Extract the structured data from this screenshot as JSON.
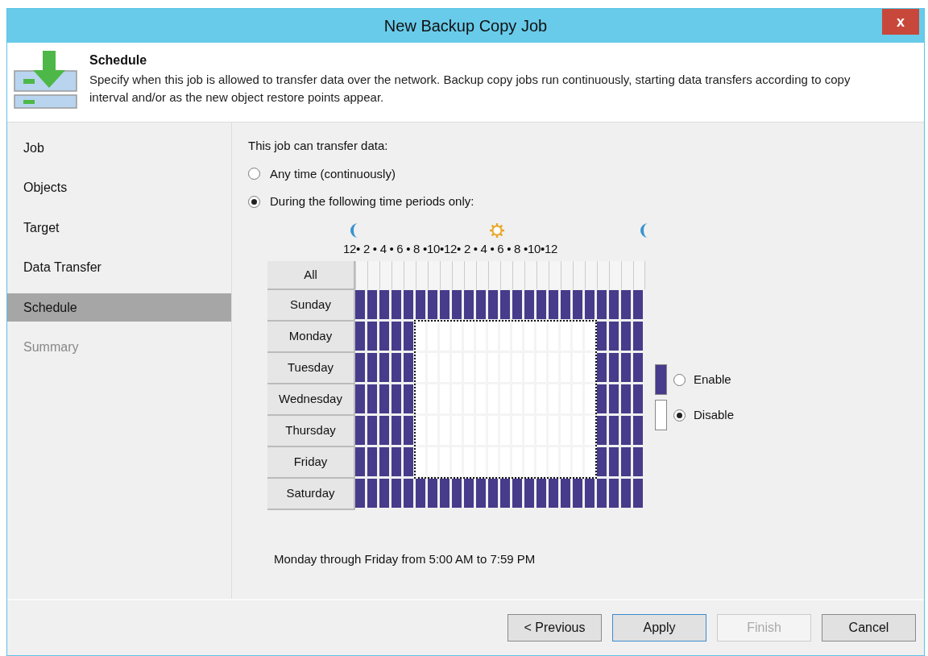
{
  "window": {
    "title": "New Backup Copy Job",
    "close": "x"
  },
  "header": {
    "title": "Schedule",
    "description": "Specify when this job is allowed to transfer data over the network. Backup copy jobs run continuously, starting data transfers according to copy interval and/or as the new object restore points appear."
  },
  "steps": [
    {
      "label": "Job",
      "selected": false,
      "disabled": false
    },
    {
      "label": "Objects",
      "selected": false,
      "disabled": false
    },
    {
      "label": "Target",
      "selected": false,
      "disabled": false
    },
    {
      "label": "Data Transfer",
      "selected": false,
      "disabled": false
    },
    {
      "label": "Schedule",
      "selected": true,
      "disabled": false
    },
    {
      "label": "Summary",
      "selected": false,
      "disabled": true
    }
  ],
  "transfer_label": "This job can transfer data:",
  "transfer_options": [
    {
      "label": "Any time (continuously)",
      "selected": false
    },
    {
      "label": "During the following time periods only:",
      "selected": true
    }
  ],
  "hour_scale": "12• 2 • 4 • 6 • 8 •10•12• 2 • 4 • 6 • 8 •10•12",
  "all_label": "All",
  "days": [
    {
      "name": "Sunday",
      "enabled": [
        true,
        true,
        true,
        true,
        true,
        true,
        true,
        true,
        true,
        true,
        true,
        true,
        true,
        true,
        true,
        true,
        true,
        true,
        true,
        true,
        true,
        true,
        true,
        true
      ]
    },
    {
      "name": "Monday",
      "enabled": [
        true,
        true,
        true,
        true,
        true,
        false,
        false,
        false,
        false,
        false,
        false,
        false,
        false,
        false,
        false,
        false,
        false,
        false,
        false,
        false,
        true,
        true,
        true,
        true
      ]
    },
    {
      "name": "Tuesday",
      "enabled": [
        true,
        true,
        true,
        true,
        true,
        false,
        false,
        false,
        false,
        false,
        false,
        false,
        false,
        false,
        false,
        false,
        false,
        false,
        false,
        false,
        true,
        true,
        true,
        true
      ]
    },
    {
      "name": "Wednesday",
      "enabled": [
        true,
        true,
        true,
        true,
        true,
        false,
        false,
        false,
        false,
        false,
        false,
        false,
        false,
        false,
        false,
        false,
        false,
        false,
        false,
        false,
        true,
        true,
        true,
        true
      ]
    },
    {
      "name": "Thursday",
      "enabled": [
        true,
        true,
        true,
        true,
        true,
        false,
        false,
        false,
        false,
        false,
        false,
        false,
        false,
        false,
        false,
        false,
        false,
        false,
        false,
        false,
        true,
        true,
        true,
        true
      ]
    },
    {
      "name": "Friday",
      "enabled": [
        true,
        true,
        true,
        true,
        true,
        false,
        false,
        false,
        false,
        false,
        false,
        false,
        false,
        false,
        false,
        false,
        false,
        false,
        false,
        false,
        true,
        true,
        true,
        true
      ]
    },
    {
      "name": "Saturday",
      "enabled": [
        true,
        true,
        true,
        true,
        true,
        true,
        true,
        true,
        true,
        true,
        true,
        true,
        true,
        true,
        true,
        true,
        true,
        true,
        true,
        true,
        true,
        true,
        true,
        true
      ]
    }
  ],
  "paint_options": [
    {
      "label": "Enable",
      "kind": "enable",
      "selected": false
    },
    {
      "label": "Disable",
      "kind": "disable",
      "selected": true
    }
  ],
  "summary": "Monday through Friday from 5:00 AM to 7:59 PM",
  "buttons": [
    {
      "label": "< Previous",
      "disabled": false,
      "focused": false
    },
    {
      "label": "Apply",
      "disabled": false,
      "focused": true
    },
    {
      "label": "Finish",
      "disabled": true,
      "focused": false
    },
    {
      "label": "Cancel",
      "disabled": false,
      "focused": false
    }
  ]
}
